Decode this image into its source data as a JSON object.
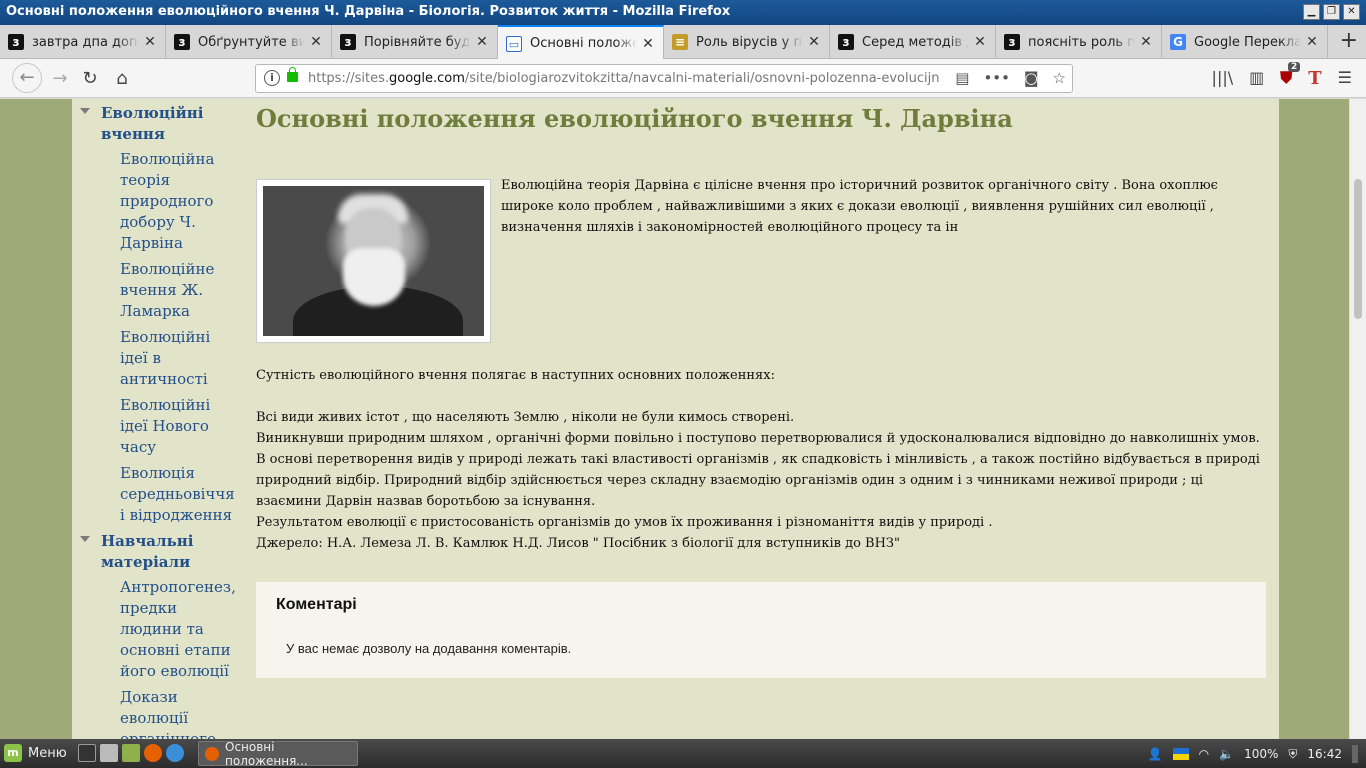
{
  "window": {
    "title": "Основні положення еволюційного вчення Ч. Дарвіна - Біологія. Розвиток життя - Mozilla Firefox"
  },
  "tabs": [
    {
      "label": "завтра дпа допомо",
      "icon": "z"
    },
    {
      "label": "Обґрунтуйте вигід",
      "icon": "z"
    },
    {
      "label": "Порівняйте будову",
      "icon": "z"
    },
    {
      "label": "Основні положення",
      "icon": "doc",
      "active": true
    },
    {
      "label": "Роль вірусів у при",
      "icon": "lib"
    },
    {
      "label": "Серед методів дос",
      "icon": "z"
    },
    {
      "label": "поясніть роль при",
      "icon": "z"
    },
    {
      "label": "Google Перекладач",
      "icon": "gt"
    }
  ],
  "navbar": {
    "url_prefix": "https://sites.",
    "url_host": "google.com",
    "url_rest": "/site/biologiarozvitokzitta/navcalni-materiali/osnovni-polozenna-evolucijnogo-vcenna",
    "library_badge": "2"
  },
  "sidebar": {
    "sections": [
      {
        "label": "Еволюційні вчення",
        "items": [
          "Еволюційна теорія природного добору Ч. Дарвіна",
          "Еволюційне вчення Ж. Ламарка",
          "Еволюційні ідеї в античності",
          "Еволюційні ідеї Нового часу",
          "Еволюція середньовіччя і відродження"
        ]
      },
      {
        "label": "Навчальні матеріали",
        "items": [
          "Антропогенез, предки людини та основні етапи його еволюції",
          "Докази еволюції органічного світу"
        ]
      }
    ]
  },
  "content": {
    "title": "Основні положення еволюційного вчення Ч. Дарвіна",
    "intro": "Еволюційна теорія Дарвіна є цілісне вчення про історичний розвиток органічного світу . Вона охоплює широке коло проблем , найважливішими з яких є докази еволюції , виявлення рушійних сил еволюції , визначення шляхів і закономірностей еволюційного процесу та ін",
    "lead": "Сутність еволюційного вчення полягає в наступних основних положеннях:",
    "points": [
      "Всі види живих істот , що населяють Землю , ніколи не були кимось створені.",
      "Виникнувши природним шляхом , органічні форми повільно і поступово перетворювалися й удосконалювалися відповідно до навколишніх умов.",
      "В основі перетворення видів у природі лежать такі властивості організмів , як спадковість і мінливість , а також постійно відбувається в природі природний відбір. Природний відбір здійснюється через складну взаємодію організмів один з одним і з чинниками неживої природи ; ці взаємини Дарвін назвав боротьбою за існування.",
      "Результатом еволюції є пристосованість організмів до умов їх проживання і різноманіття видів у природі .",
      "Джерело: Н.А. Лемеза Л. В. Камлюк Н.Д. Лисов \" Посібник з біології для вступників до ВНЗ\""
    ],
    "comments_title": "Коментарі",
    "comments_msg": "У вас немає дозволу на додавання коментарів."
  },
  "taskbar": {
    "menu_label": "Меню",
    "window_label": "Основні положення...",
    "volume": "100%",
    "clock": "16:42"
  }
}
